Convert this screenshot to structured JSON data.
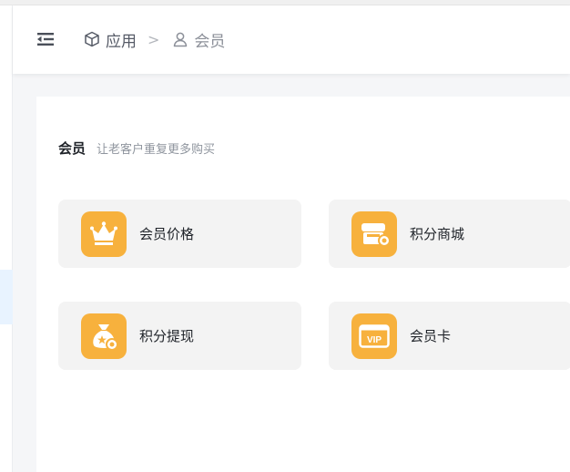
{
  "header": {
    "menu_icon": "menu-fold-icon",
    "breadcrumb": [
      {
        "label": "应用",
        "icon": "cube-icon"
      },
      {
        "label": "会员",
        "icon": "user-icon"
      }
    ],
    "separator": ">"
  },
  "section": {
    "title": "会员",
    "subtitle": "让老客户重复更多购买"
  },
  "cards": [
    {
      "label": "会员价格",
      "icon": "crown-icon"
    },
    {
      "label": "积分商城",
      "icon": "store-icon"
    },
    {
      "label": "积分提现",
      "icon": "money-bag-icon"
    },
    {
      "label": "会员卡",
      "icon": "vip-card-icon"
    }
  ],
  "colors": {
    "accent": "#f7b13d",
    "card_bg": "#f3f3f3",
    "sidebar_active": "#e8f3ff"
  }
}
